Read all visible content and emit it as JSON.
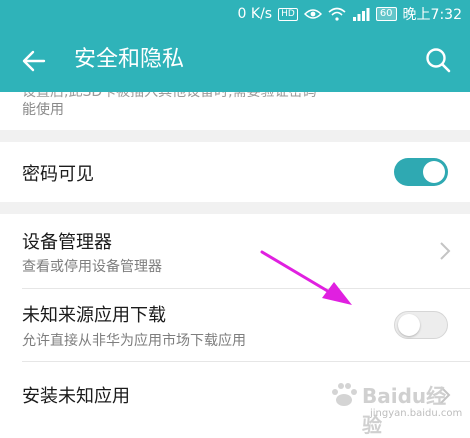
{
  "status_bar": {
    "speed": "0 K/s",
    "hd_label": "HD",
    "battery": "60",
    "time": "晚上7:32"
  },
  "app_bar": {
    "title": "安全和隐私",
    "back_icon": "back-arrow-icon",
    "search_icon": "search-icon"
  },
  "clipped_text": {
    "line_partial": "设置后,此SD卡被插入其他设备时,需要验证密码",
    "line2": "能使用"
  },
  "items": [
    {
      "title": "密码可见",
      "toggle": "on"
    },
    {
      "title": "设备管理器",
      "subtitle": "查看或停用设备管理器"
    },
    {
      "title": "未知来源应用下载",
      "subtitle": "允许直接从非华为应用市场下载应用",
      "toggle": "off"
    },
    {
      "title": "安装未知应用"
    }
  ],
  "colors": {
    "accent": "#2fb3b9",
    "toggle_on": "#2fa9b2",
    "annotation_arrow": "#e020e0"
  },
  "watermark": {
    "text": "Baidu经验",
    "url": "jingyan.baidu.com"
  }
}
